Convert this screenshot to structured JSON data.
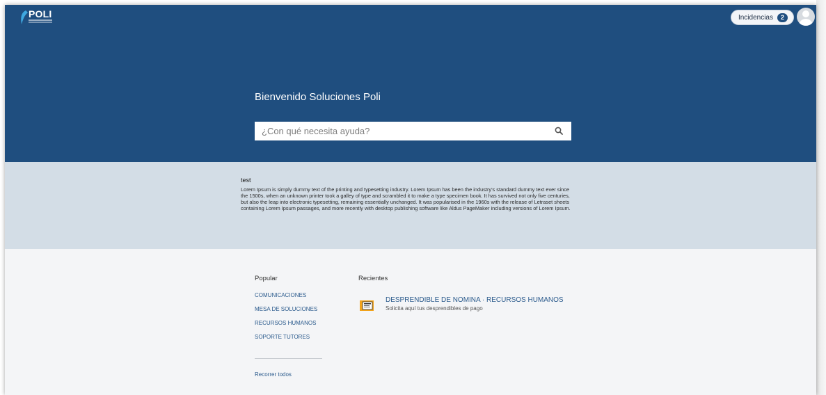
{
  "header": {
    "logo_text": "POLI",
    "issues_label": "Incidencias",
    "issues_count": "2",
    "avatar_icon": "user-avatar-icon"
  },
  "hero": {
    "welcome": "Bienvenido Soluciones Poli",
    "search_placeholder": "¿Con qué necesita ayuda?",
    "search_icon": "search-icon"
  },
  "announcement": {
    "title": "test",
    "body": "Lorem Ipsum is simply dummy text of the printing and typesetting industry. Lorem Ipsum has been the industry's standard dummy text ever since the 1500s, when an unknown printer took a galley of type and scrambled it to make a type specimen book. It has survived not only five centuries, but also the leap into electronic typesetting, remaining essentially unchanged. It was popularised in the 1960s with the release of Letraset sheets containing Lorem Ipsum passages, and more recently with desktop publishing software like Aldus PageMaker including versions of Lorem Ipsum."
  },
  "popular": {
    "heading": "Popular",
    "items": [
      {
        "label": "COMUNICACIONES"
      },
      {
        "label": "MESA DE SOLUCIONES"
      },
      {
        "label": "RECURSOS HUMANOS"
      },
      {
        "label": "SOPORTE TUTORES"
      }
    ],
    "browse_all": "Recorrer todos"
  },
  "recent": {
    "heading": "Recientes",
    "items": [
      {
        "title": "DESPRENDIBLE DE NOMINA · RECURSOS HUMANOS",
        "description": "Solicita aquí tus desprendibles de pago",
        "icon": "payslip-icon"
      }
    ]
  },
  "colors": {
    "hero_bg": "#1f4e7f",
    "announce_bg": "#d3dde6",
    "link": "#2a5a8c",
    "page_bg": "#f4f5f7"
  }
}
